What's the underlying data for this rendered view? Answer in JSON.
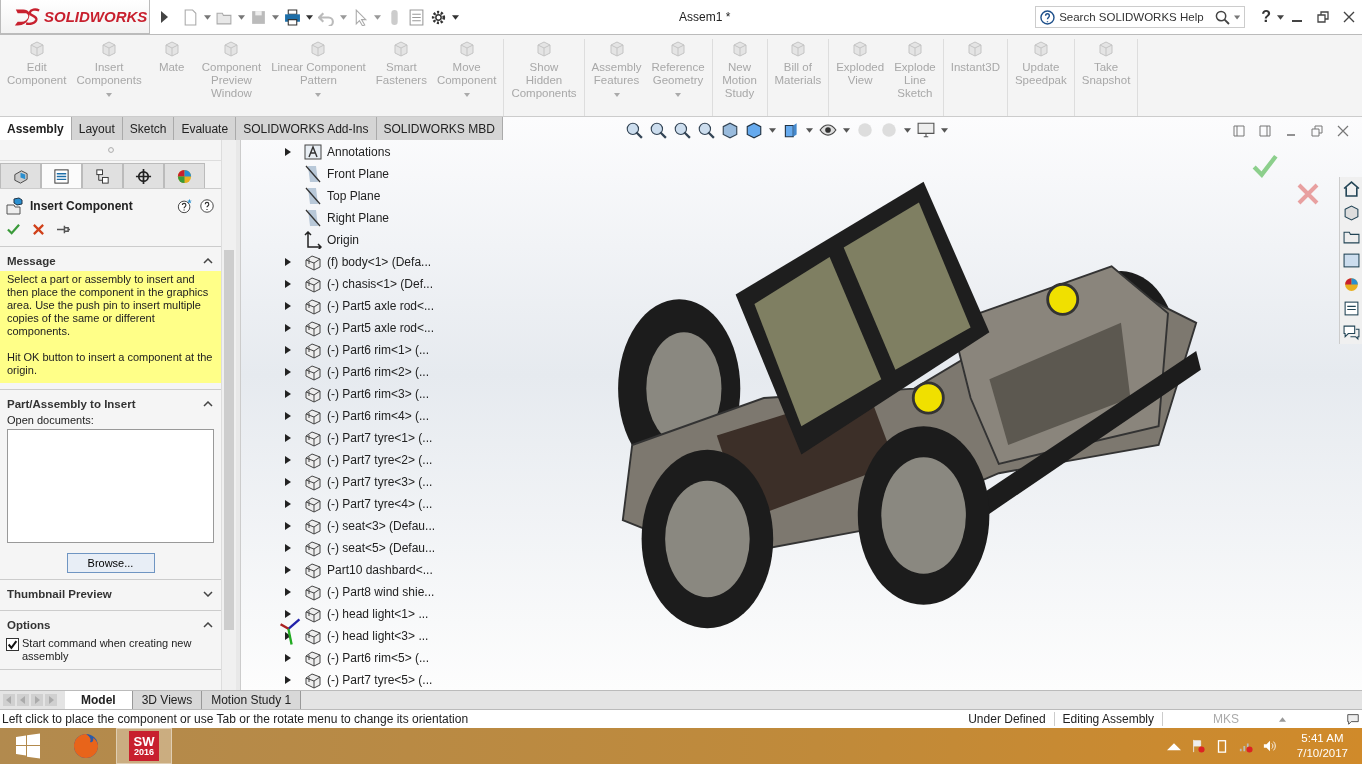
{
  "app": {
    "logo": "SOLIDWORKS",
    "title": "Assem1 *",
    "search": {
      "placeholder": "Search SOLIDWORKS Help"
    },
    "help": "?"
  },
  "ribbon": {
    "groups": [
      [
        {
          "label": "Edit\nComponent",
          "dropdown": false,
          "disabled": true
        },
        {
          "label": "Insert\nComponents",
          "dropdown": true,
          "disabled": true
        },
        {
          "label": "Mate",
          "dropdown": false,
          "disabled": true
        },
        {
          "label": "Component\nPreview\nWindow",
          "dropdown": false,
          "disabled": true
        },
        {
          "label": "Linear Component\nPattern",
          "dropdown": true,
          "disabled": true
        },
        {
          "label": "Smart\nFasteners",
          "dropdown": false,
          "disabled": true
        },
        {
          "label": "Move\nComponent",
          "dropdown": true,
          "disabled": true
        }
      ],
      [
        {
          "label": "Show\nHidden\nComponents",
          "dropdown": false,
          "disabled": true
        }
      ],
      [
        {
          "label": "Assembly\nFeatures",
          "dropdown": true,
          "disabled": true
        },
        {
          "label": "Reference\nGeometry",
          "dropdown": true,
          "disabled": true
        }
      ],
      [
        {
          "label": "New\nMotion\nStudy",
          "dropdown": false,
          "disabled": true
        }
      ],
      [
        {
          "label": "Bill of\nMaterials",
          "dropdown": false,
          "disabled": true
        }
      ],
      [
        {
          "label": "Exploded\nView",
          "dropdown": false,
          "disabled": true
        },
        {
          "label": "Explode\nLine\nSketch",
          "dropdown": false,
          "disabled": true
        }
      ],
      [
        {
          "label": "Instant3D",
          "dropdown": false,
          "disabled": true
        }
      ],
      [
        {
          "label": "Update\nSpeedpak",
          "dropdown": false,
          "disabled": true
        }
      ],
      [
        {
          "label": "Take\nSnapshot",
          "dropdown": false,
          "disabled": true
        }
      ]
    ]
  },
  "tabs": [
    {
      "label": "Assembly",
      "selected": true
    },
    {
      "label": "Layout",
      "selected": false
    },
    {
      "label": "Sketch",
      "selected": false
    },
    {
      "label": "Evaluate",
      "selected": false
    },
    {
      "label": "SOLIDWORKS Add-Ins",
      "selected": false
    },
    {
      "label": "SOLIDWORKS MBD",
      "selected": false
    }
  ],
  "panel_tabs": [
    {
      "selected": false
    },
    {
      "selected": true
    },
    {
      "selected": false
    },
    {
      "selected": false
    },
    {
      "selected": false
    }
  ],
  "property_manager": {
    "title": "Insert Component",
    "sections": [
      {
        "kind": "message",
        "title": "Message",
        "expanded": true,
        "paragraphs": [
          "Select a part or assembly to insert and then place the component in the graphics area. Use the push pin to insert multiple copies of the same or different components.",
          "Hit OK button to insert a component at the origin."
        ]
      },
      {
        "kind": "insert",
        "title": "Part/Assembly to Insert",
        "expanded": true,
        "list_label": "Open documents:",
        "button": "Browse..."
      },
      {
        "title": "Thumbnail Preview",
        "expanded": false
      },
      {
        "kind": "options",
        "title": "Options",
        "expanded": true,
        "checkbox": {
          "label": "Start command when creating new assembly",
          "checked": true
        }
      }
    ]
  },
  "tree": [
    {
      "kind": "annotations",
      "label": "Annotations",
      "expander": true
    },
    {
      "kind": "plane",
      "label": "Front Plane",
      "expander": false
    },
    {
      "kind": "plane",
      "label": "Top Plane",
      "expander": false
    },
    {
      "kind": "plane",
      "label": "Right Plane",
      "expander": false
    },
    {
      "kind": "origin",
      "label": "Origin",
      "expander": false
    },
    {
      "kind": "part",
      "label": "(f) body<1> (Defa...",
      "expander": true
    },
    {
      "kind": "part",
      "label": "(-) chasis<1> (Def...",
      "expander": true
    },
    {
      "kind": "part",
      "label": "(-) Part5 axle rod<...",
      "expander": true
    },
    {
      "kind": "part",
      "label": "(-) Part5 axle rod<...",
      "expander": true
    },
    {
      "kind": "part",
      "label": "(-) Part6 rim<1> (...",
      "expander": true
    },
    {
      "kind": "part",
      "label": "(-) Part6 rim<2> (...",
      "expander": true
    },
    {
      "kind": "part",
      "label": "(-) Part6 rim<3> (...",
      "expander": true
    },
    {
      "kind": "part",
      "label": "(-) Part6 rim<4> (...",
      "expander": true
    },
    {
      "kind": "part",
      "label": "(-) Part7 tyre<1> (...",
      "expander": true
    },
    {
      "kind": "part",
      "label": "(-) Part7 tyre<2> (...",
      "expander": true
    },
    {
      "kind": "part",
      "label": "(-) Part7 tyre<3> (...",
      "expander": true
    },
    {
      "kind": "part",
      "label": "(-) Part7 tyre<4> (...",
      "expander": true
    },
    {
      "kind": "part",
      "label": "(-) seat<3> (Defau...",
      "expander": true
    },
    {
      "kind": "part",
      "label": "(-) seat<5> (Defau...",
      "expander": true
    },
    {
      "kind": "part",
      "label": "Part10 dashbard<...",
      "expander": true
    },
    {
      "kind": "part",
      "label": "(-) Part8 wind shie...",
      "expander": true
    },
    {
      "kind": "part",
      "label": "(-) head light<1> ...",
      "expander": true
    },
    {
      "kind": "part",
      "label": "(-) head light<3> ...",
      "expander": true
    },
    {
      "kind": "part",
      "label": "(-) Part6 rim<5> (...",
      "expander": true
    },
    {
      "kind": "part",
      "label": "(-) Part7 tyre<5> (...",
      "expander": true
    }
  ],
  "bottom_tabs": [
    {
      "label": "Model",
      "selected": true
    },
    {
      "label": "3D Views",
      "selected": false
    },
    {
      "label": "Motion Study 1",
      "selected": false
    }
  ],
  "status_bar": {
    "message": "Left click to place the component or use Tab or the rotate menu to change its orientation",
    "state": "Under Defined",
    "mode": "Editing Assembly",
    "units": "MKS"
  },
  "taskbar": {
    "apps": [
      {
        "kind": "start",
        "selected": false
      },
      {
        "kind": "firefox",
        "selected": false
      },
      {
        "kind": "solidworks",
        "selected": true,
        "text": "SW",
        "year": "2016"
      }
    ],
    "time": "5:41 AM",
    "date": "7/10/2017"
  }
}
